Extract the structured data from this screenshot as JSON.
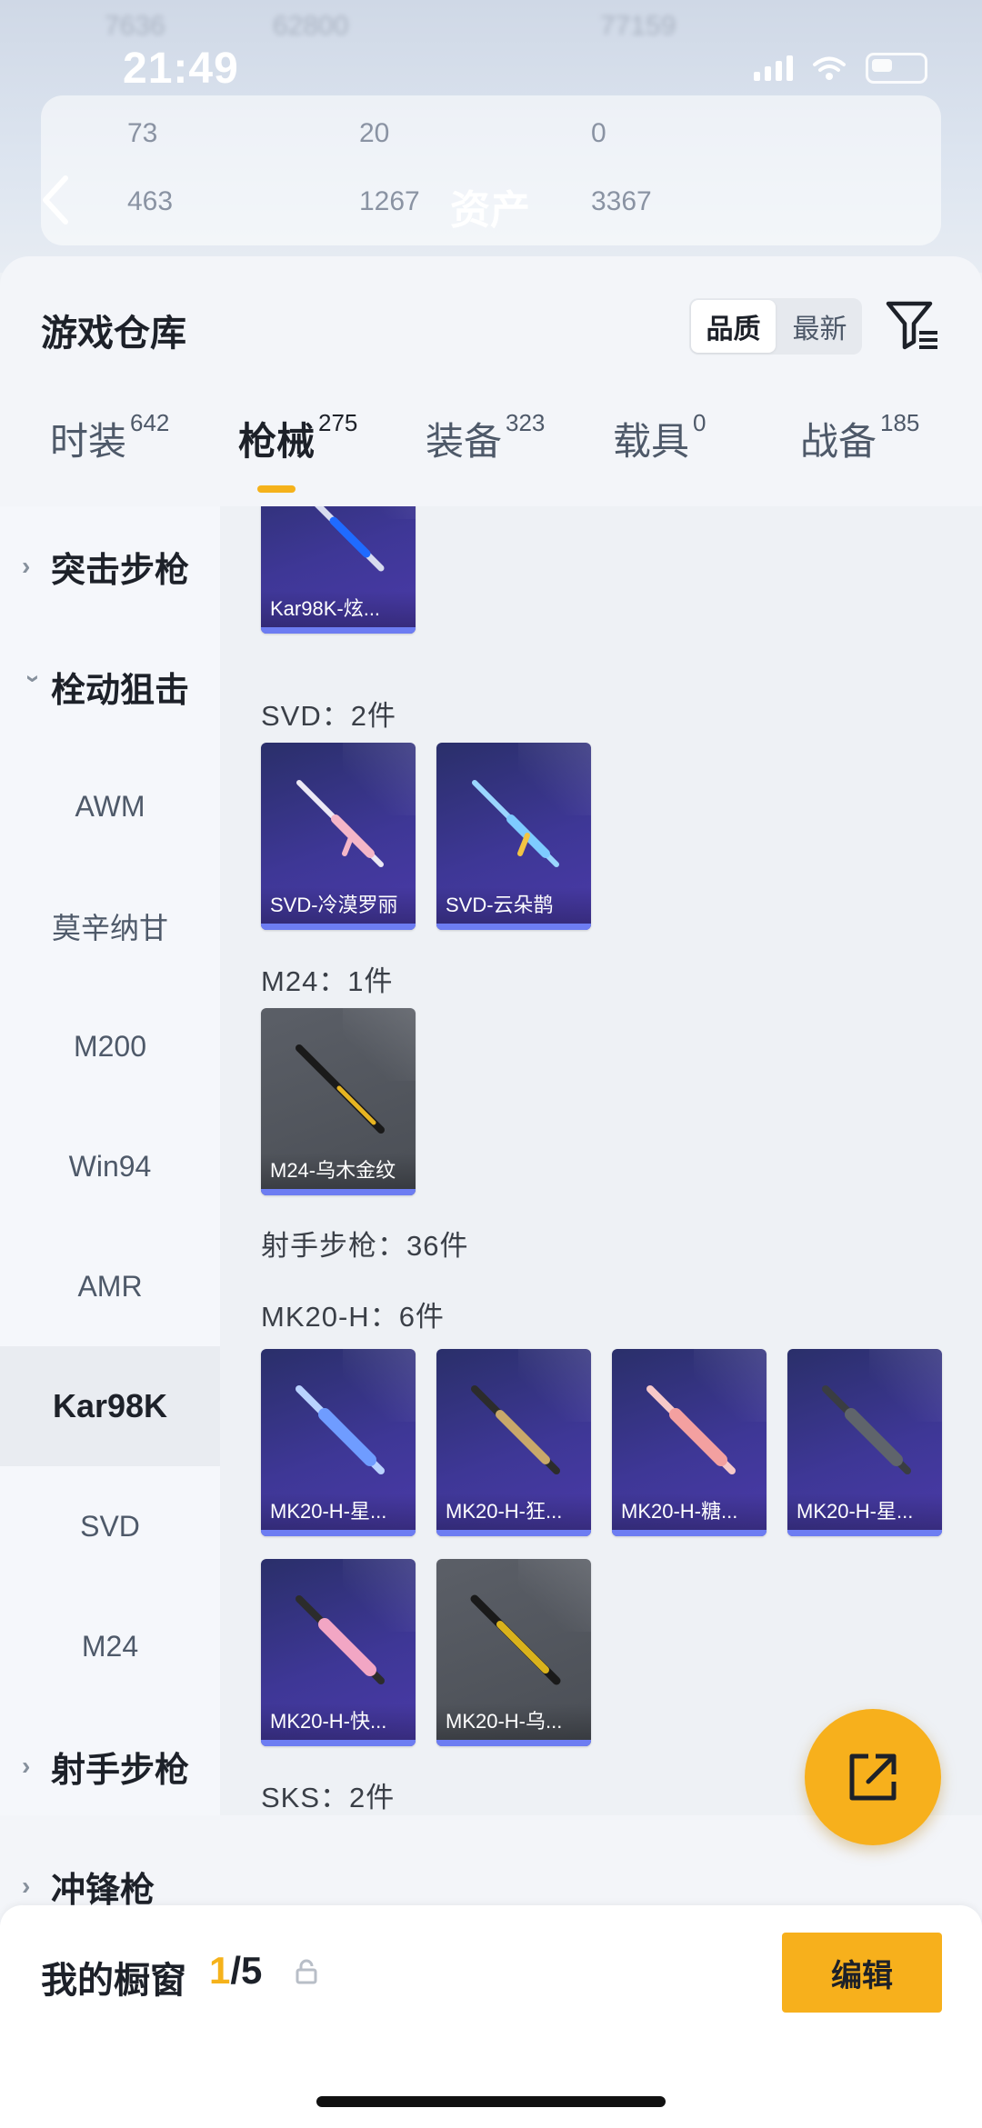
{
  "status_bar": {
    "time": "21:49"
  },
  "background_header": {
    "title": "资产",
    "stats_top": [
      "73",
      "20",
      "0"
    ],
    "stats_bottom": [
      "463",
      "1267",
      "3367"
    ],
    "faint_top": [
      "7636",
      "62800",
      "77159"
    ]
  },
  "sheet": {
    "title": "游戏仓库",
    "sort": {
      "options": [
        "品质",
        "最新"
      ],
      "active": "品质"
    }
  },
  "tabs": [
    {
      "label": "时装",
      "count": "642"
    },
    {
      "label": "枪械",
      "count": "275",
      "active": true
    },
    {
      "label": "装备",
      "count": "323"
    },
    {
      "label": "载具",
      "count": "0"
    },
    {
      "label": "战备",
      "count": "185"
    }
  ],
  "sidebar": {
    "items": [
      {
        "label": "突击步枪",
        "type": "group",
        "expanded": false
      },
      {
        "label": "栓动狙击",
        "type": "group",
        "expanded": true
      },
      {
        "label": "AWM",
        "type": "sub"
      },
      {
        "label": "莫辛纳甘",
        "type": "sub"
      },
      {
        "label": "M200",
        "type": "sub"
      },
      {
        "label": "Win94",
        "type": "sub"
      },
      {
        "label": "AMR",
        "type": "sub"
      },
      {
        "label": "Kar98K",
        "type": "sub",
        "selected": true
      },
      {
        "label": "SVD",
        "type": "sub"
      },
      {
        "label": "M24",
        "type": "sub"
      },
      {
        "label": "射手步枪",
        "type": "group",
        "expanded": false
      },
      {
        "label": "冲锋枪",
        "type": "group",
        "expanded": false
      }
    ]
  },
  "content": {
    "top_card": {
      "name": "Kar98K-炫...",
      "tone": "purple",
      "accent": "#1f6bff"
    },
    "sections": {
      "svd": {
        "label": "SVD：2件",
        "cards": [
          {
            "name": "SVD-冷漠罗丽",
            "tone": "purple",
            "accent": "#f4b6c8"
          },
          {
            "name": "SVD-云朵鹊",
            "tone": "purple",
            "accent": "#7ecbff"
          }
        ]
      },
      "m24": {
        "label": "M24：1件",
        "cards": [
          {
            "name": "M24-乌木金纹",
            "tone": "grey",
            "accent": "#e6b422"
          }
        ]
      },
      "marksman": {
        "label": "射手步枪：36件"
      },
      "mk20": {
        "label": "MK20-H：6件",
        "cards": [
          {
            "name": "MK20-H-星...",
            "tone": "purple",
            "accent": "#8fb8ff"
          },
          {
            "name": "MK20-H-狂...",
            "tone": "purple",
            "accent": "#c9a86a"
          },
          {
            "name": "MK20-H-糖...",
            "tone": "purple",
            "accent": "#f3a0a0"
          },
          {
            "name": "MK20-H-星...",
            "tone": "purple",
            "accent": "#5f646b"
          },
          {
            "name": "MK20-H-快...",
            "tone": "purple",
            "accent": "#f2a6c4"
          },
          {
            "name": "MK20-H-乌...",
            "tone": "grey",
            "accent": "#d9b21c"
          }
        ]
      },
      "sks": {
        "label": "SKS：2件",
        "cards": [
          {
            "name": "",
            "tone": "purple",
            "accent": "#c8a050"
          },
          {
            "name": "",
            "tone": "purple",
            "accent": "#e0406a"
          }
        ]
      }
    }
  },
  "bottom_bar": {
    "label": "我的橱窗",
    "current": "1",
    "total": "/5",
    "edit_label": "编辑"
  },
  "colors": {
    "accent": "#f7b01c",
    "card_bar": "#6d7df2"
  }
}
